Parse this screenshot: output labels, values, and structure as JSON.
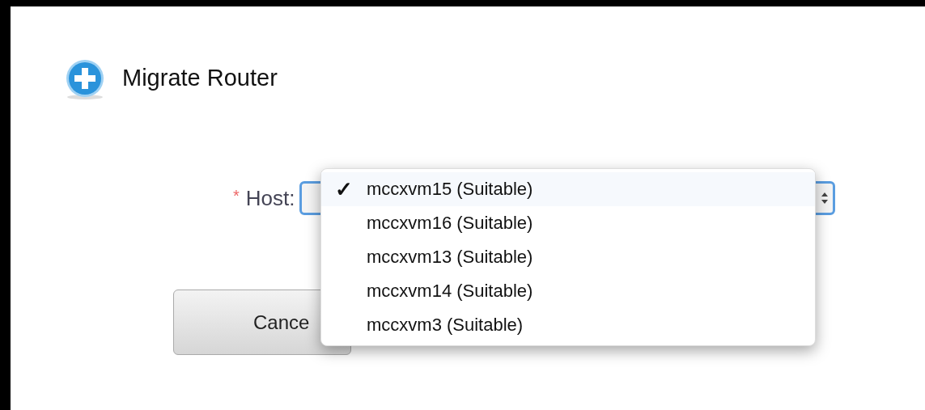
{
  "dialog": {
    "title": "Migrate Router"
  },
  "host_field": {
    "required_mark": "*",
    "label": "Host:"
  },
  "host_menu": {
    "check_mark": "✓",
    "options": [
      {
        "label": "mccxvm15 (Suitable)",
        "selected": true
      },
      {
        "label": "mccxvm16 (Suitable)",
        "selected": false
      },
      {
        "label": "mccxvm13 (Suitable)",
        "selected": false
      },
      {
        "label": "mccxvm14 (Suitable)",
        "selected": false
      },
      {
        "label": "mccxvm3 (Suitable)",
        "selected": false
      }
    ]
  },
  "buttons": [
    {
      "label": "Cance"
    }
  ]
}
